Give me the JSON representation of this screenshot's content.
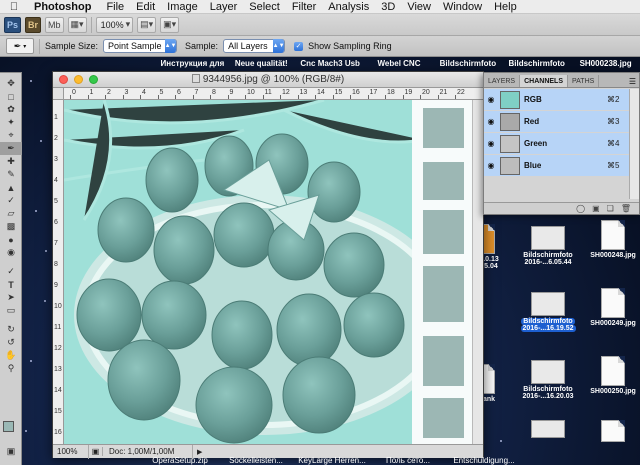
{
  "menubar": {
    "app": "Photoshop",
    "items": [
      "File",
      "Edit",
      "Image",
      "Layer",
      "Select",
      "Filter",
      "Analysis",
      "3D",
      "View",
      "Window",
      "Help"
    ]
  },
  "appbar": {
    "ps_label": "Ps",
    "br_label": "Br",
    "mb_label": "Mb",
    "zoom": "100%"
  },
  "options": {
    "sample_size_label": "Sample Size:",
    "sample_size_value": "Point Sample",
    "sample_label": "Sample:",
    "sample_value": "All Layers",
    "sampling_ring_label": "Show Sampling Ring",
    "sampling_ring_checked": true
  },
  "desktop_top_labels": [
    "Инструкция для",
    "Neue qualität!",
    "Cnc Mach3 Usb",
    "Webel CNC",
    "Bildschirmfoto",
    "Bildschirmfoto",
    "SH000238.jpg"
  ],
  "document": {
    "title": "9344956.jpg @ 100% (RGB/8#)",
    "zoom": "100%",
    "doc_info": "Doc: 1,00M/1,00M",
    "ruler_top": [
      "0",
      "1",
      "2",
      "3",
      "4",
      "5",
      "6",
      "7",
      "8",
      "9",
      "10",
      "11",
      "12",
      "13",
      "14",
      "15",
      "16",
      "17",
      "18",
      "19",
      "20",
      "21",
      "22"
    ],
    "ruler_left": [
      "1",
      "2",
      "3",
      "4",
      "5",
      "6",
      "7",
      "8",
      "9",
      "10",
      "11",
      "12",
      "13",
      "14",
      "15",
      "16"
    ],
    "colors": {
      "canvas_tint": "#8fd8d0",
      "strawberry": "#6a9f99",
      "tile": "#9cb7b4"
    }
  },
  "panel": {
    "tabs": [
      "LAYERS",
      "CHANNELS",
      "PATHS"
    ],
    "active_tab": "CHANNELS",
    "channels": [
      {
        "name": "RGB",
        "shortcut": "⌘2"
      },
      {
        "name": "Red",
        "shortcut": "⌘3"
      },
      {
        "name": "Green",
        "shortcut": "⌘4"
      },
      {
        "name": "Blue",
        "shortcut": "⌘5"
      }
    ],
    "selection_color": "#b7d4f7"
  },
  "desktop_icons": [
    {
      "label": "1.0.13",
      "label2": "05.04",
      "kind": "doc"
    },
    {
      "label": "Bildschirmfoto",
      "label2": "2016-...6.05.44",
      "kind": "shot"
    },
    {
      "label": "SH000248.jpg",
      "kind": "doc"
    },
    {
      "label": "Bildschirmfoto",
      "label2": "2016-...16.19.52",
      "kind": "shot",
      "selected": true
    },
    {
      "label": "SH000249.jpg",
      "kind": "doc"
    },
    {
      "label": "Bildschirmfoto",
      "label2": "2016-...16.20.03",
      "kind": "shot"
    },
    {
      "label": "SH000250.jpg",
      "kind": "doc"
    },
    {
      "label": "ank",
      "kind": "doc"
    }
  ],
  "dock_labels": [
    "OperaSetup.zip",
    "Sockelleisten...",
    "KeyLarge Herren...",
    "Поль сето...",
    "Entschuldigung..."
  ],
  "tool_icons": [
    "move",
    "marquee",
    "lasso",
    "quick-select",
    "crop",
    "eyedropper",
    "healing",
    "brush",
    "stamp",
    "history-brush",
    "eraser",
    "gradient",
    "blur",
    "dodge",
    "pen",
    "type",
    "path-select",
    "shape",
    "3d-rotate",
    "3d-orbit",
    "hand",
    "zoom"
  ]
}
